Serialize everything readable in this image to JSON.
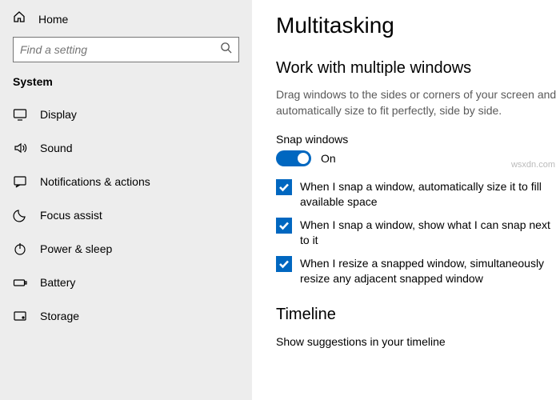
{
  "sidebar": {
    "home": "Home",
    "search_placeholder": "Find a setting",
    "category": "System",
    "items": [
      {
        "label": "Display"
      },
      {
        "label": "Sound"
      },
      {
        "label": "Notifications & actions"
      },
      {
        "label": "Focus assist"
      },
      {
        "label": "Power & sleep"
      },
      {
        "label": "Battery"
      },
      {
        "label": "Storage"
      }
    ]
  },
  "main": {
    "title": "Multitasking",
    "section1": {
      "heading": "Work with multiple windows",
      "description": "Drag windows to the sides or corners of your screen and automatically size to fit perfectly, side by side.",
      "snap_label": "Snap windows",
      "toggle_state": "On",
      "options": [
        "When I snap a window, automatically size it to fill available space",
        "When I snap a window, show what I can snap next to it",
        "When I resize a snapped window, simultaneously resize any adjacent snapped window"
      ]
    },
    "section2": {
      "heading": "Timeline",
      "sub": "Show suggestions in your timeline"
    }
  },
  "watermark": "wsxdn.com"
}
